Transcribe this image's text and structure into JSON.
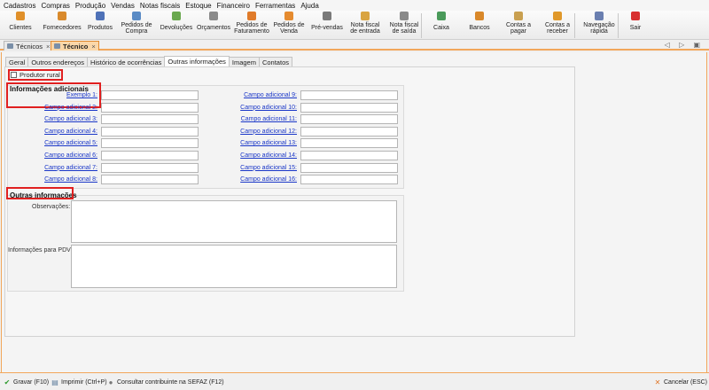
{
  "menu": [
    "Cadastros",
    "Compras",
    "Produção",
    "Vendas",
    "Notas fiscais",
    "Estoque",
    "Financeiro",
    "Ferramentas",
    "Ajuda"
  ],
  "toolbar": [
    {
      "line1": "",
      "line2": "Clientes",
      "icon": "clients-icon",
      "color": "#e0902a"
    },
    {
      "line1": "",
      "line2": "Fornecedores",
      "icon": "suppliers-icon",
      "color": "#d98a2c"
    },
    {
      "line1": "",
      "line2": "Produtos",
      "icon": "products-icon",
      "color": "#4f72b8"
    },
    {
      "line1": "Pedidos de",
      "line2": "Compra",
      "icon": "purchase-orders-icon",
      "color": "#5a8bc5"
    },
    {
      "line1": "",
      "line2": "Devoluções",
      "icon": "returns-icon",
      "color": "#6aa84f"
    },
    {
      "line1": "",
      "line2": "Orçamentos",
      "icon": "quotes-icon",
      "color": "#8a8a8a"
    },
    {
      "line1": "Pedidos de",
      "line2": "Faturamento",
      "icon": "billing-orders-icon",
      "color": "#e07b2a"
    },
    {
      "line1": "Pedidos de",
      "line2": "Venda",
      "icon": "sales-orders-icon",
      "color": "#e58b2f"
    },
    {
      "line1": "",
      "line2": "Pré-vendas",
      "icon": "pre-sales-icon",
      "color": "#7a7a7a"
    },
    {
      "line1": "Nota fiscal",
      "line2": "de entrada",
      "icon": "invoice-in-icon",
      "color": "#d9a441"
    },
    {
      "line1": "Nota fiscal",
      "line2": "de saída",
      "icon": "invoice-out-icon",
      "color": "#8a8a8a"
    },
    {
      "line1": "",
      "line2": "Caixa",
      "icon": "cash-icon",
      "color": "#4a9a5a"
    },
    {
      "line1": "",
      "line2": "Bancos",
      "icon": "banks-icon",
      "color": "#d9882a"
    },
    {
      "line1": "Contas a",
      "line2": "pagar",
      "icon": "payables-icon",
      "color": "#c9a050"
    },
    {
      "line1": "Contas a",
      "line2": "receber",
      "icon": "receivables-icon",
      "color": "#e0982a"
    },
    {
      "line1": "Navegação",
      "line2": "rápida",
      "icon": "quick-nav-icon",
      "color": "#6a7fb0"
    },
    {
      "line1": "",
      "line2": "Sair",
      "icon": "exit-icon",
      "color": "#d83030"
    }
  ],
  "form_tabs": [
    {
      "label": "Técnicos",
      "close": "×"
    },
    {
      "label": "Técnico",
      "close": "×"
    }
  ],
  "nav_arrows": "◁ ▷ ▣",
  "sub_tabs": [
    "Geral",
    "Outros endereços",
    "Histórico de ocorrências",
    "Outras informações",
    "Imagem",
    "Contatos"
  ],
  "checkbox_label": "Produtor rural",
  "checkbox_checked": false,
  "group1_title": "Informações adicionais",
  "fields_left": [
    "Exemplo 1:",
    "Campo adicional 2:",
    "Campo adicional 3:",
    "Campo adicional 4:",
    "Campo adicional 5:",
    "Campo adicional 6:",
    "Campo adicional 7:",
    "Campo adicional 8:"
  ],
  "fields_right": [
    "Campo adicional 9:",
    "Campo adicional 10:",
    "Campo adicional 11:",
    "Campo adicional 12:",
    "Campo adicional 13:",
    "Campo adicional 14:",
    "Campo adicional 15:",
    "Campo adicional 16:"
  ],
  "group2_title": "Outras informações",
  "obs_label": "Observações:",
  "pdv_label": "Informações para PDV:",
  "status": {
    "save": "Gravar (F10)",
    "print": "Imprimir (Ctrl+P)",
    "sefaz": "Consultar contribuinte na SEFAZ (F12)",
    "cancel": "Cancelar (ESC)"
  },
  "colors": {
    "accent": "#f2a65a",
    "highlight": "#e02020",
    "link": "#1a37c8"
  }
}
